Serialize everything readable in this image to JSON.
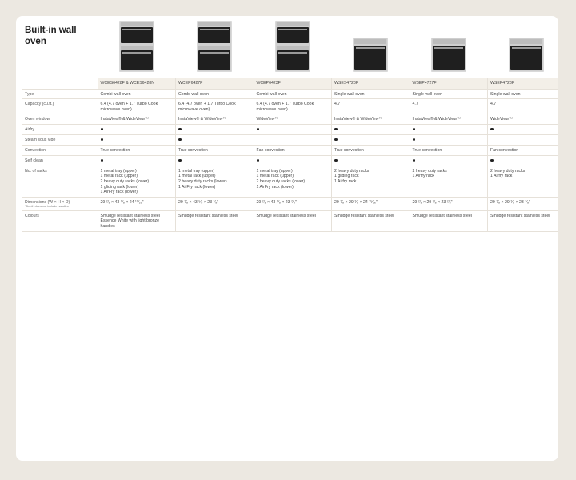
{
  "title": "Built-in wall oven",
  "models": [
    "WCES6428F & WCES6428N",
    "WCEP6427F",
    "WCEP6423F",
    "WSES4728F",
    "WSEP4727F",
    "WSEP4723F"
  ],
  "oven_types": [
    "combi",
    "combi",
    "combi",
    "single",
    "single",
    "single"
  ],
  "colors": {
    "steel": "#d9d9d9",
    "dark": "#1f1f1f",
    "panel": "#e8e4dd"
  },
  "rows": [
    {
      "label": "Type",
      "note": "",
      "cells": [
        [
          "Combi wall oven"
        ],
        [
          "Combi wall oven"
        ],
        [
          "Combi wall oven"
        ],
        [
          "Single wall oven"
        ],
        [
          "Single wall oven"
        ],
        [
          "Single wall oven"
        ]
      ]
    },
    {
      "label": "Capacity (cu.ft.)",
      "note": "",
      "cells": [
        [
          "6.4 (4.7 oven + 1.7 Turbo Cook",
          "microwave oven)"
        ],
        [
          "6.4 (4.7 oven + 1.7 Turbo Cook",
          "microwave oven)"
        ],
        [
          "6.4 (4.7 oven + 1.7 Turbo Cook",
          "microwave oven)"
        ],
        [
          "4.7"
        ],
        [
          "4.7"
        ],
        [
          "4.7"
        ]
      ]
    },
    {
      "label": "Oven window",
      "note": "",
      "cells": [
        [
          "InstaView® & WideView™"
        ],
        [
          "InstaView® & WideView™"
        ],
        [
          "WideView™"
        ],
        [
          "InstaView® & WideView™"
        ],
        [
          "InstaView® & WideView™"
        ],
        [
          "WideView™"
        ]
      ]
    },
    {
      "label": "Airfry",
      "note": "",
      "dots": [
        true,
        true,
        true,
        true,
        true,
        true
      ]
    },
    {
      "label": "Steam sous vide",
      "note": "",
      "dots": [
        true,
        true,
        false,
        true,
        true,
        false
      ]
    },
    {
      "label": "Convection",
      "note": "",
      "cells": [
        [
          "True convection"
        ],
        [
          "True convection"
        ],
        [
          "Fan convection"
        ],
        [
          "True convection"
        ],
        [
          "True convection"
        ],
        [
          "Fan convection"
        ]
      ]
    },
    {
      "label": "Self clean",
      "note": "",
      "dots": [
        true,
        true,
        true,
        true,
        true,
        true
      ]
    },
    {
      "label": "No. of racks",
      "note": "",
      "cells": [
        [
          "1 metal tray (upper)",
          "1 metal rack (upper)",
          "2 heavy duty racks (lower)",
          "1 gliding rack (lower)",
          "1 AirFry rack (lower)"
        ],
        [
          "1 metal tray (upper)",
          "1 metal rack (upper)",
          "2 heavy duty racks (lower)",
          "1 AirFry rack (lower)"
        ],
        [
          "1 metal tray (upper)",
          "1 metal rack (upper)",
          "2 heavy duty racks (lower)",
          "1 AirFry rack (lower)"
        ],
        [
          "2 heavy duty racks",
          "1 gliding rack",
          "1 Airfry rack"
        ],
        [
          "2 heavy duty racks",
          "1 Airfry rack"
        ],
        [
          "2 heavy duty racks",
          "1 Airfry rack"
        ]
      ]
    },
    {
      "label": "Dimensions (W × H × D)",
      "note": "*Depth does not include handles",
      "cells": [
        [
          "29 ⁷⁄₈ × 43 ⁵⁄₈ × 24 ¹⁵⁄₁₆\""
        ],
        [
          "29 ⁷⁄₈ × 43 ⁵⁄₈ × 23 ⁷⁄₈\""
        ],
        [
          "29 ⁷⁄₈ × 43 ⁵⁄₈ × 23 ⁷⁄₈\""
        ],
        [
          "29 ⁷⁄₈ × 29 ⁷⁄₈ × 24 ¹⁵⁄₁₆\""
        ],
        [
          "29 ⁷⁄₈ × 29 ⁷⁄₈ × 23 ⁷⁄₈\""
        ],
        [
          "29 ⁷⁄₈ × 29 ⁷⁄₈ × 23 ⁷⁄₈\""
        ]
      ]
    },
    {
      "label": "Colours",
      "note": "",
      "cells": [
        [
          "Smudge resistant stainless steel",
          "Essence White with light bronze",
          "handles"
        ],
        [
          "Smudge resistant stainless steel"
        ],
        [
          "Smudge resistant stainless steel"
        ],
        [
          "Smudge resistant stainless steel"
        ],
        [
          "Smudge resistant stainless steel"
        ],
        [
          "Smudge resistant stainless steel"
        ]
      ]
    }
  ]
}
